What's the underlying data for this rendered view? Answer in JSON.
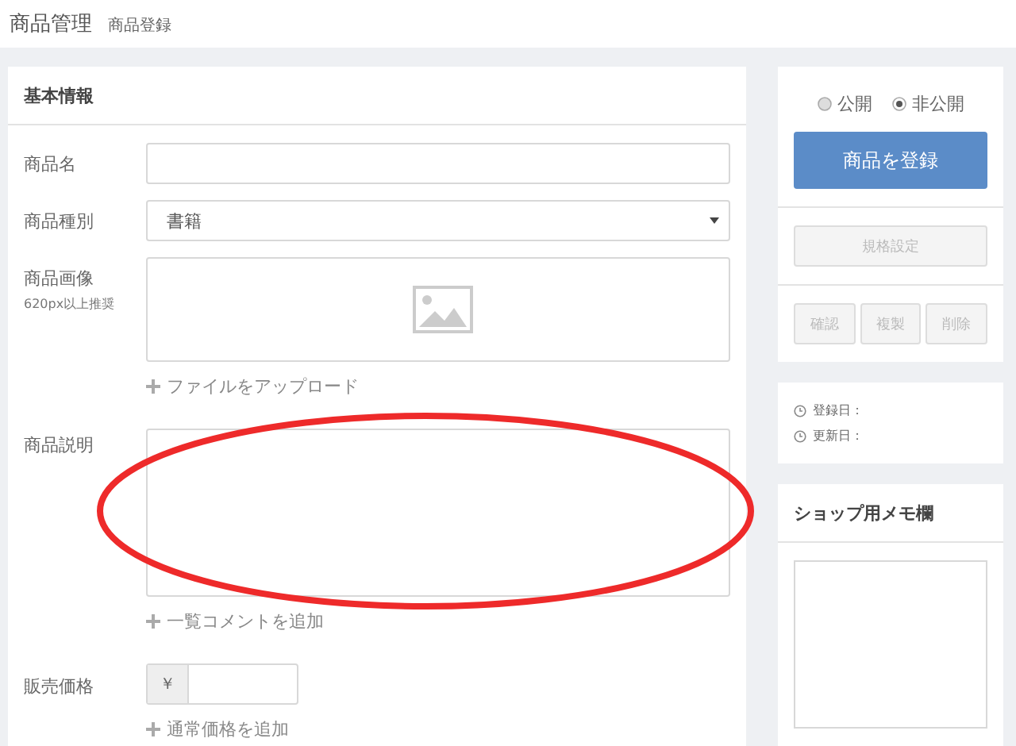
{
  "header": {
    "title": "商品管理",
    "subtitle": "商品登録"
  },
  "basic": {
    "title": "基本情報",
    "fields": [
      {
        "kind": "text",
        "label": "商品名"
      },
      {
        "kind": "select",
        "label": "商品種別",
        "value": "書籍"
      },
      {
        "kind": "image",
        "label": "商品画像",
        "note": "620px以上推奨",
        "link": "ファイルをアップロード"
      },
      {
        "kind": "textarea",
        "label": "商品説明",
        "link": "一覧コメントを追加"
      },
      {
        "kind": "price",
        "label": "販売価格",
        "prefix": "￥",
        "link": "通常価格を追加"
      }
    ]
  },
  "publish": {
    "options": [
      {
        "label": "公開",
        "selected": false
      },
      {
        "label": "非公開",
        "selected": true
      }
    ],
    "primary": "商品を登録",
    "spec": {
      "label": "規格設定",
      "disabled": true
    },
    "actions": [
      {
        "label": "確認",
        "disabled": true
      },
      {
        "label": "複製",
        "disabled": true
      },
      {
        "label": "削除",
        "disabled": true
      }
    ]
  },
  "dates": [
    "登録日：",
    "更新日："
  ],
  "memo": {
    "title": "ショップ用メモ欄"
  },
  "annotation": {
    "kind": "ellipse"
  }
}
